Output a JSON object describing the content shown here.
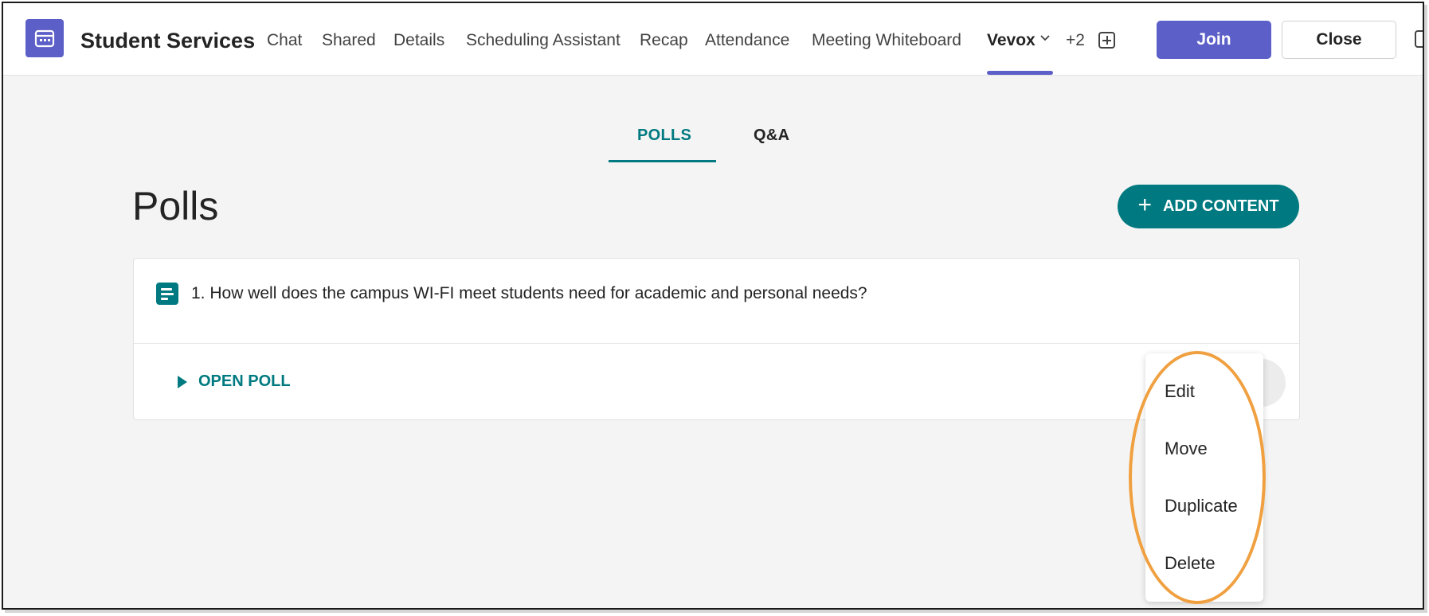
{
  "header": {
    "title": "Student Services",
    "tabs": [
      {
        "label": "Chat"
      },
      {
        "label": "Shared"
      },
      {
        "label": "Details"
      },
      {
        "label": "Scheduling Assistant"
      },
      {
        "label": "Recap"
      },
      {
        "label": "Attendance"
      },
      {
        "label": "Meeting Whiteboard"
      },
      {
        "label": "Vevox"
      }
    ],
    "active_tab": "Vevox",
    "more_tabs": "+2",
    "join_label": "Join",
    "close_label": "Close"
  },
  "vevox": {
    "subtabs": [
      {
        "label": "POLLS"
      },
      {
        "label": "Q&A"
      }
    ],
    "active_subtab": "POLLS",
    "page_title": "Polls",
    "add_content_label": "ADD CONTENT",
    "polls": [
      {
        "question": "1. How well does the campus WI-FI meet students need for academic and personal needs?",
        "action_label": "OPEN POLL"
      }
    ],
    "context_menu": [
      {
        "label": "Edit"
      },
      {
        "label": "Move"
      },
      {
        "label": "Duplicate"
      },
      {
        "label": "Delete"
      }
    ]
  },
  "colors": {
    "teams_purple": "#5b5fc7",
    "vevox_teal": "#007a80",
    "highlight_orange": "#f0a040"
  },
  "icons": [
    "calendar-icon",
    "chevron-down-icon",
    "add-tab-icon",
    "popout-icon",
    "poll-icon",
    "play-icon",
    "plus-icon"
  ]
}
